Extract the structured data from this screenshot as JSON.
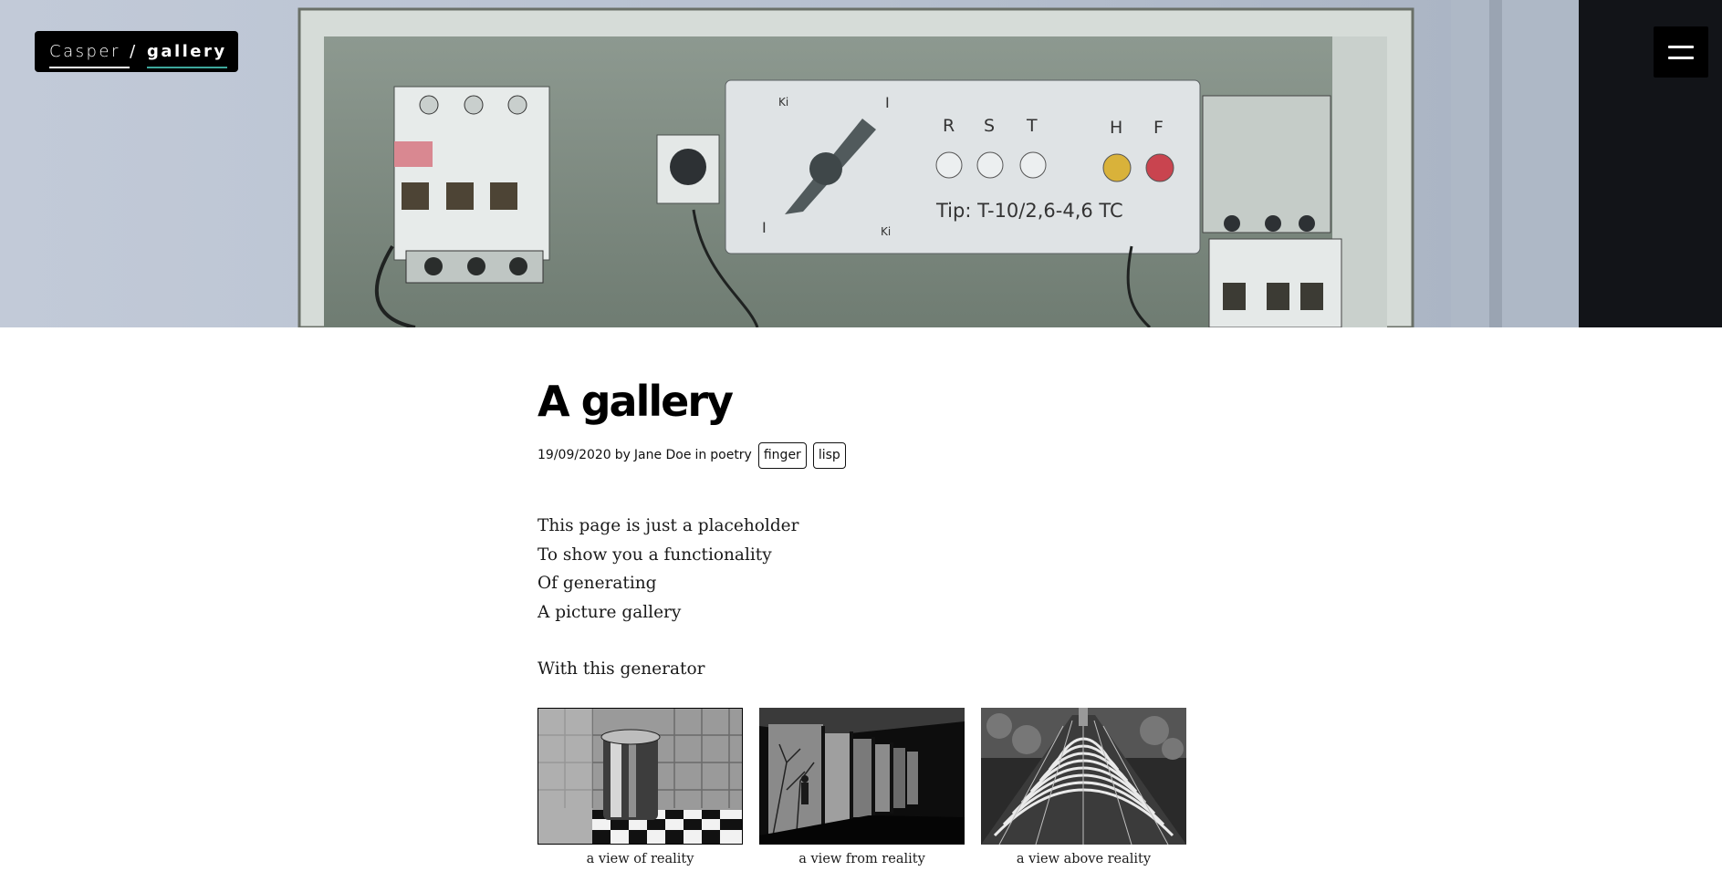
{
  "header": {
    "site_name": "Casper",
    "separator": "/",
    "page_name": "gallery",
    "menu_icon": "hamburger-menu-icon"
  },
  "hero": {
    "panel_labels": {
      "rst": [
        "R",
        "S",
        "T"
      ],
      "hf": [
        "H",
        "F"
      ],
      "dial_top": "I",
      "dial_bottom": "I",
      "dial_ki_top": "Ki",
      "dial_ki_bottom": "Ki",
      "model": "Tip: T-10/2,6-4,6 TC"
    }
  },
  "article": {
    "title": "A gallery",
    "meta": {
      "date": "19/09/2020",
      "by": "by",
      "author": "Jane Doe",
      "in": "in",
      "category": "poetry",
      "tags": [
        "finger",
        "lisp"
      ]
    },
    "body": {
      "lines": [
        "This page is just a placeholder",
        "To show you a functionality",
        "Of generating",
        "A picture gallery"
      ],
      "closing": "With this generator"
    },
    "gallery": [
      {
        "caption": "a view of reality"
      },
      {
        "caption": "a view from reality"
      },
      {
        "caption": "a view above reality"
      }
    ]
  },
  "colors": {
    "brand_bg": "#000000",
    "brand_underline_accent": "#3da89c",
    "text": "#111111",
    "hero_wall": "#b9c2cf"
  }
}
